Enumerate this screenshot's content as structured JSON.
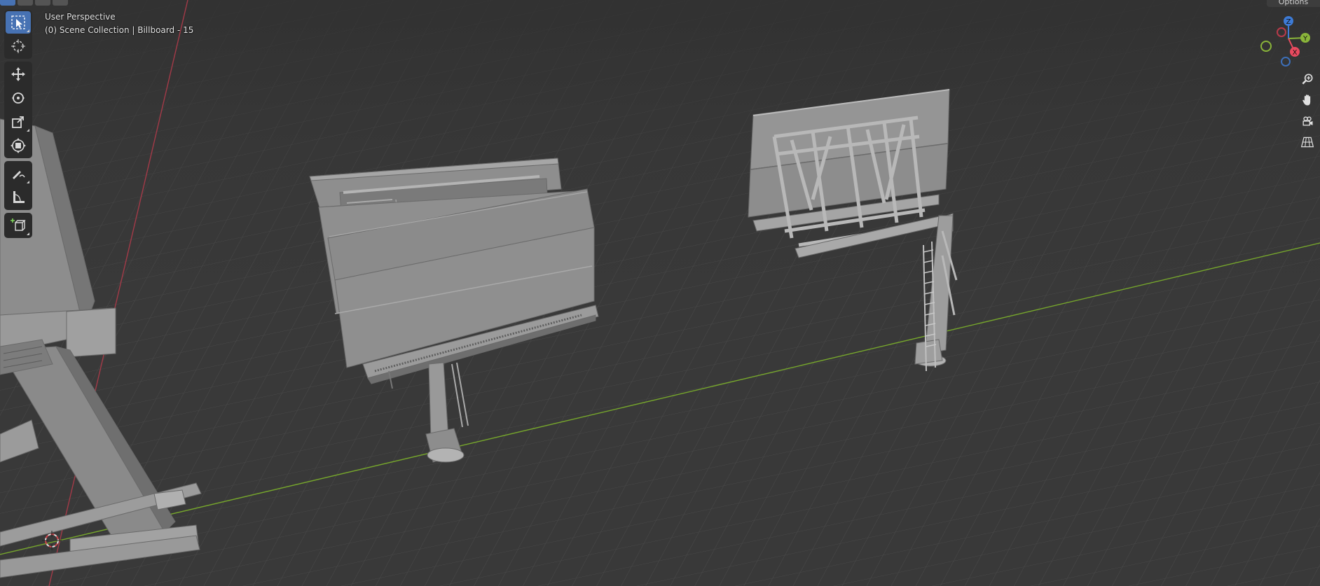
{
  "viewport": {
    "view_name": "User Perspective",
    "collection_line": "(0) Scene Collection | Billboard - 15"
  },
  "header": {
    "options_label": "Options"
  },
  "toolbar": {
    "tools": [
      {
        "name": "select-box",
        "active": true
      },
      {
        "name": "cursor"
      },
      {
        "name": "move"
      },
      {
        "name": "rotate"
      },
      {
        "name": "scale"
      },
      {
        "name": "transform"
      },
      {
        "name": "annotate"
      },
      {
        "name": "measure"
      },
      {
        "name": "add-cube"
      }
    ]
  },
  "gizmo": {
    "axes": [
      "Z",
      "Y",
      "X"
    ],
    "colors": {
      "x": "#e84a5f",
      "y": "#8ab53a",
      "z": "#3d7bd6"
    }
  },
  "nav_controls": [
    "zoom-icon",
    "pan-hand-icon",
    "camera-icon",
    "grid-view-icon"
  ],
  "colors": {
    "background": "#393939",
    "grid": "#4a4a4a",
    "x_axis": "#9b3a44",
    "y_axis": "#6e9a2a",
    "mesh": "#8c8c8c",
    "active_tool": "#4772b3"
  }
}
